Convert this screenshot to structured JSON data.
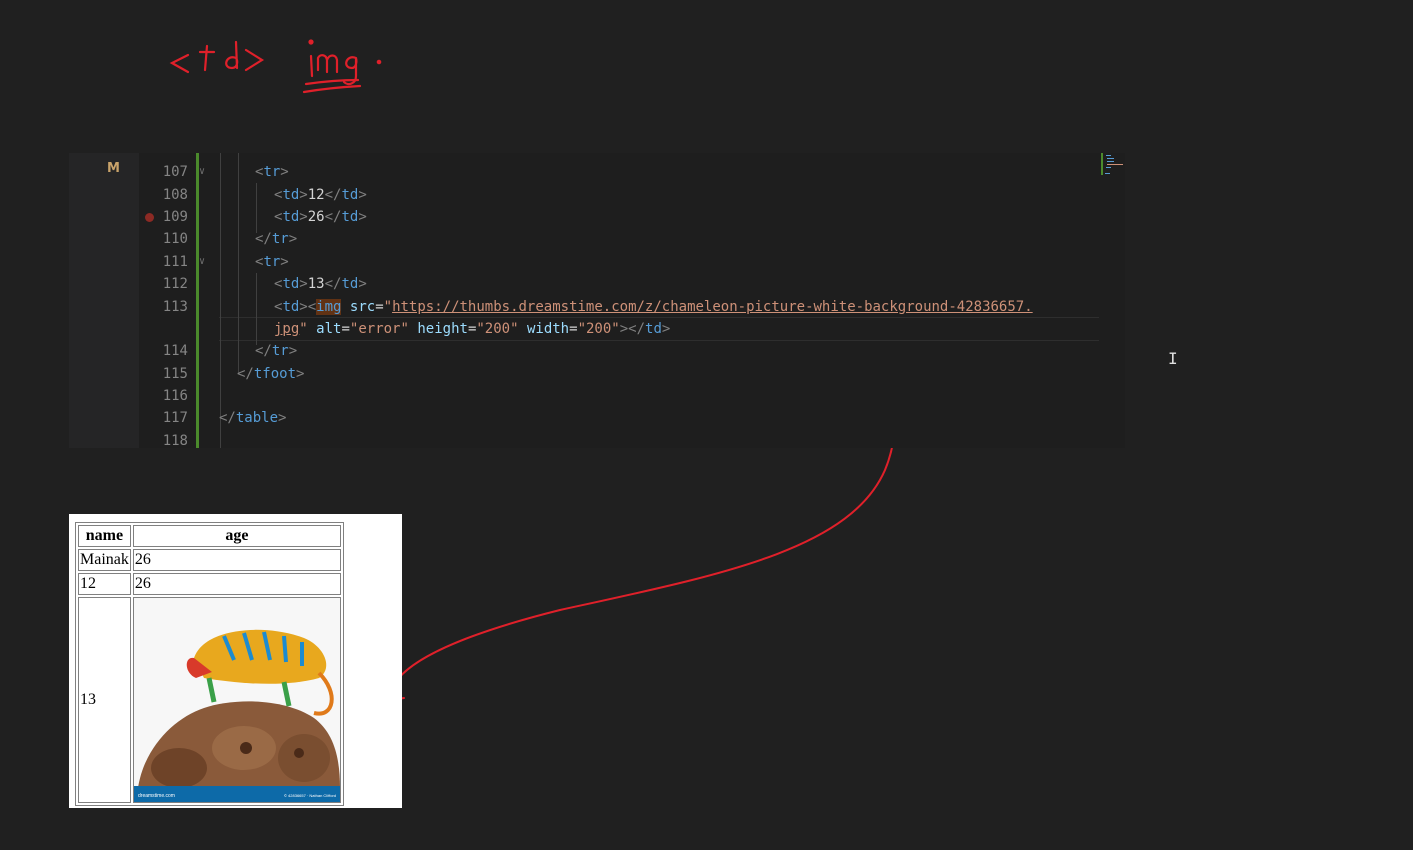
{
  "handwriting": {
    "line1": "<td>",
    "line2": "img."
  },
  "editor": {
    "scm_marker": "M",
    "lines": [
      {
        "num": "107"
      },
      {
        "num": "108",
        "text": "12"
      },
      {
        "num": "109",
        "text": "26"
      },
      {
        "num": "110"
      },
      {
        "num": "111"
      },
      {
        "num": "112",
        "text": "13"
      },
      {
        "num": "113"
      },
      {
        "num": "114"
      },
      {
        "num": "115"
      },
      {
        "num": "116"
      },
      {
        "num": "117"
      },
      {
        "num": "118"
      }
    ],
    "tokens": {
      "td": "td",
      "tr": "tr",
      "tfoot": "tfoot",
      "table": "table",
      "img": "img",
      "src": "src",
      "url_part1": "https://thumbs.dreamstime.com/z/chameleon-picture-white-background-42836657.",
      "url_part2": "jpg",
      "alt": "alt",
      "alt_val": "\"error\"",
      "height": "height",
      "height_val": "\"200\"",
      "width": "width",
      "width_val": "\"200\""
    }
  },
  "preview": {
    "headers": [
      "name",
      "age"
    ],
    "rows": [
      [
        "Mainak",
        "26"
      ],
      [
        "12",
        "26"
      ]
    ],
    "last_row_label": "13",
    "image_caption_left": "dreamstime.com",
    "image_caption_right": "© 42836657 · Nathan Clifford"
  },
  "colors": {
    "background": "#202020",
    "annotation": "#e0202a",
    "git_added": "#4b8a2c",
    "tag": "#569cd6",
    "attribute": "#9cdcfe",
    "string": "#ce9178"
  }
}
